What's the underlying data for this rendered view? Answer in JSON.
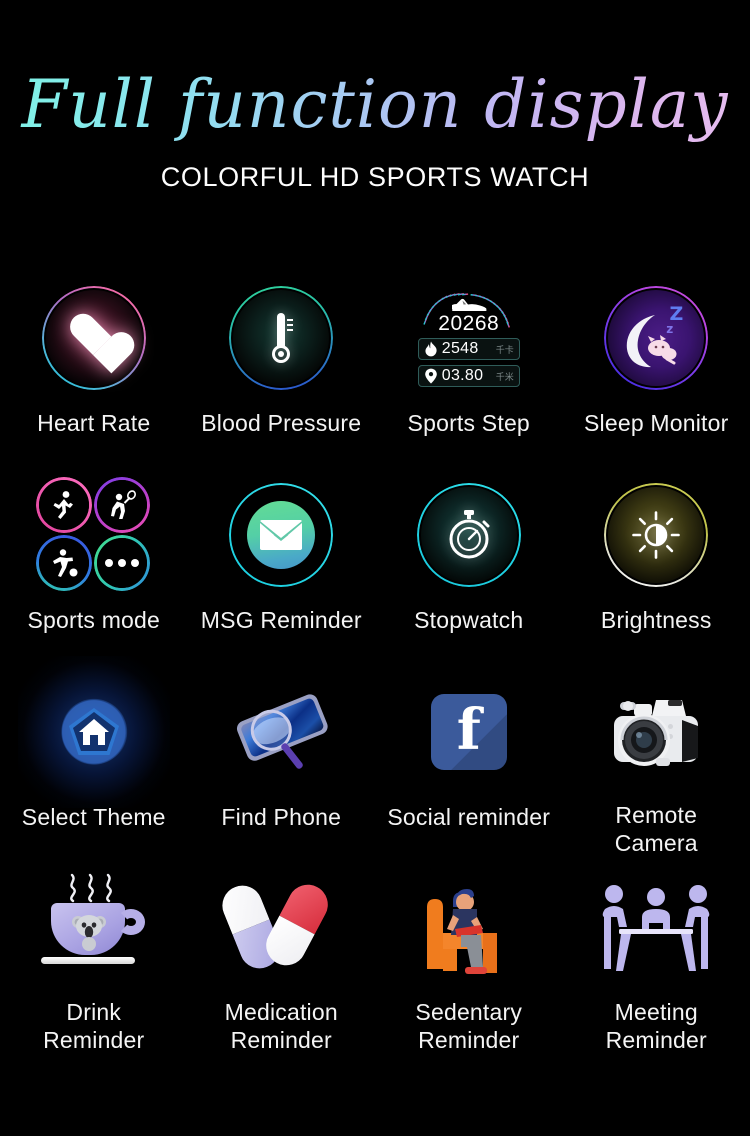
{
  "header": {
    "title": "Full function display",
    "subtitle": "COLORFUL HD SPORTS WATCH",
    "title_gradient_from": "#7ff2e6",
    "title_gradient_to": "#e7bdf0",
    "background": "#000000"
  },
  "features": [
    {
      "label": "Heart Rate",
      "icon": "heart-icon",
      "accent": "#f06ba8"
    },
    {
      "label": "Blood Pressure",
      "icon": "thermometer-icon",
      "accent": "#2fd39a"
    },
    {
      "label": "Sports Step",
      "icon": "step-gauge-icon",
      "accent": "#19cfe0"
    },
    {
      "label": "Sleep Monitor",
      "icon": "moon-sleep-icon",
      "accent": "#b845e2"
    },
    {
      "label": "Sports mode",
      "icon": "sports-quad-icon",
      "accent": "#f05bb0"
    },
    {
      "label": "MSG Reminder",
      "icon": "envelope-icon",
      "accent": "#2ad7e6"
    },
    {
      "label": "Stopwatch",
      "icon": "stopwatch-icon",
      "accent": "#21d4e4"
    },
    {
      "label": "Brightness",
      "icon": "sun-icon",
      "accent": "#cfd055"
    },
    {
      "label": "Select Theme",
      "icon": "home-bloom-icon",
      "accent": "#2f6fd8"
    },
    {
      "label": "Find Phone",
      "icon": "phone-search-icon",
      "accent": "#3a6fd0"
    },
    {
      "label": "Social reminder",
      "icon": "facebook-icon",
      "accent": "#3b5a9b"
    },
    {
      "label": "Remote\nCamera",
      "icon": "dslr-camera-icon",
      "accent": "#e8e8e8"
    },
    {
      "label": "Drink\nReminder",
      "icon": "coffee-cup-icon",
      "accent": "#b6afe8"
    },
    {
      "label": "Medication\nReminder",
      "icon": "capsules-icon",
      "accent": "#e04a5a"
    },
    {
      "label": "Sedentary\nReminder",
      "icon": "sitting-person-icon",
      "accent": "#f57c20"
    },
    {
      "label": "Meeting\nReminder",
      "icon": "meeting-table-icon",
      "accent": "#bfb8ee"
    }
  ],
  "watch_face": {
    "steps": "20268",
    "calories": {
      "value": "2548",
      "unit": "千卡",
      "icon": "flame-icon"
    },
    "distance": {
      "value": "03.80",
      "unit": "千米",
      "icon": "location-pin-icon"
    },
    "shoe_icon": "running-shoe-icon"
  }
}
